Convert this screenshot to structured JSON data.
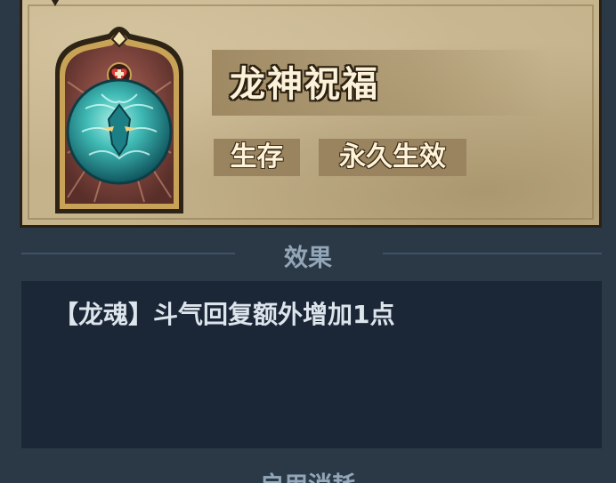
{
  "buff": {
    "name": "龙神祝福",
    "tags": [
      "生存",
      "永久生效"
    ]
  },
  "effect_section": {
    "title": "效果",
    "description": "【龙魂】斗气回复额外增加1点"
  },
  "next_section": {
    "title": "启用消耗"
  },
  "colors": {
    "background": "#2b3947",
    "parchment": "#c5b38c",
    "orb": "#3fb9b4",
    "effect_box": "#1b2636"
  },
  "icons": {
    "portrait": "dragon-orb-icon",
    "badge": "heart-plus-icon"
  }
}
